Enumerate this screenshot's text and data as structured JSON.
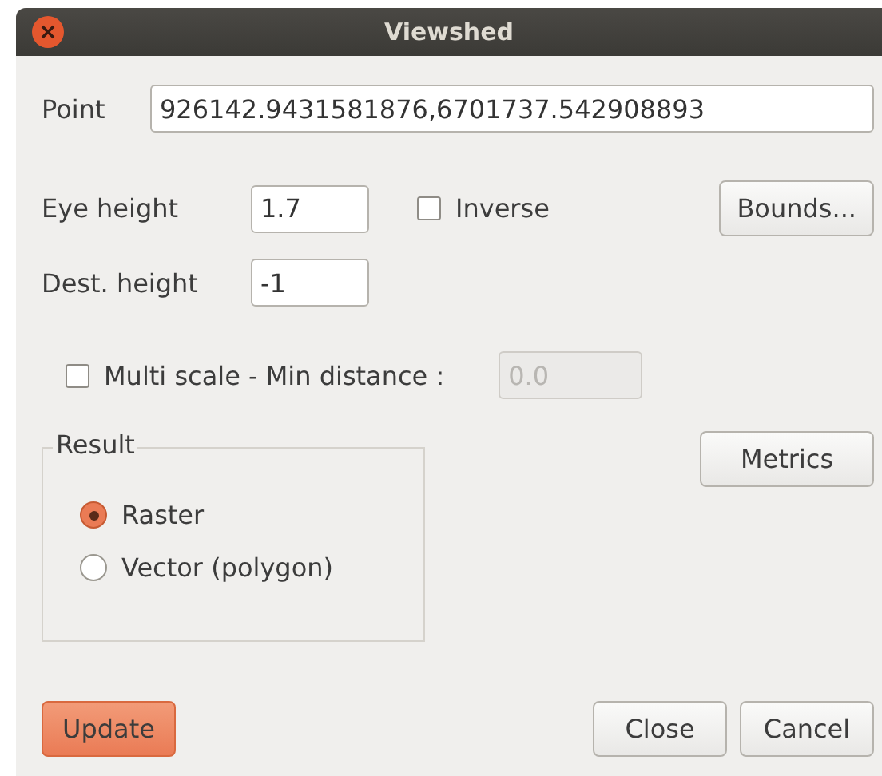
{
  "window": {
    "title": "Viewshed"
  },
  "point": {
    "label": "Point",
    "value": "926142.9431581876,6701737.542908893"
  },
  "eye_height": {
    "label": "Eye height",
    "value": "1.7"
  },
  "inverse": {
    "label": "Inverse",
    "checked": false
  },
  "bounds_button": {
    "label": "Bounds..."
  },
  "dest_height": {
    "label": "Dest. height",
    "value": "-1"
  },
  "multi_scale": {
    "label": "Multi scale - Min distance :",
    "checked": false,
    "value": "0.0",
    "disabled": true
  },
  "result": {
    "title": "Result",
    "options": [
      {
        "label": "Raster",
        "selected": true
      },
      {
        "label": "Vector (polygon)",
        "selected": false
      }
    ]
  },
  "metrics_button": {
    "label": "Metrics"
  },
  "buttons": [
    {
      "label": "Update",
      "default": true
    },
    {
      "label": "Close",
      "default": false
    },
    {
      "label": "Cancel",
      "default": false
    }
  ]
}
